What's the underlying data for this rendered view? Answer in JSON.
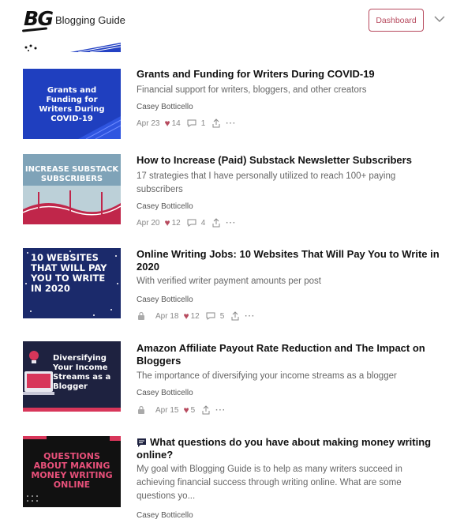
{
  "header": {
    "logo_text": "BG",
    "site_name": "Blogging Guide",
    "dashboard_label": "Dashboard"
  },
  "posts": [
    {
      "thumb_text": "Grants and Funding for Writers During COVID-19",
      "title": "Grants and Funding for Writers During COVID-19",
      "subtitle": "Financial support for writers, bloggers, and other creators",
      "author": "Casey Botticello",
      "date": "Apr 23",
      "likes": "14",
      "comments": "1",
      "locked": false
    },
    {
      "thumb_text": "INCREASE SUBSTACK SUBSCRIBERS",
      "title": "How to Increase (Paid) Substack Newsletter Subscribers",
      "subtitle": "17 strategies that I have personally utilized to reach 100+ paying subscribers",
      "author": "Casey Botticello",
      "date": "Apr 20",
      "likes": "12",
      "comments": "4",
      "locked": false
    },
    {
      "thumb_text": "10 WEBSITES THAT WILL PAY YOU TO WRITE IN 2020",
      "title": "Online Writing Jobs: 10 Websites That Will Pay You to Write in 2020",
      "subtitle": "With verified writer payment amounts per post",
      "author": "Casey Botticello",
      "date": "Apr 18",
      "likes": "12",
      "comments": "5",
      "locked": true
    },
    {
      "thumb_text": "Diversifying Your Income Streams as a Blogger",
      "title": "Amazon Affiliate Payout Rate Reduction and The Impact on Bloggers",
      "subtitle": "The importance of diversifying your income streams as a blogger",
      "author": "Casey Botticello",
      "date": "Apr 15",
      "likes": "5",
      "comments": "",
      "locked": true
    },
    {
      "thumb_text": "QUESTIONS ABOUT MAKING MONEY WRITING ONLINE",
      "title": "What questions do you have about making money writing online?",
      "subtitle": "My goal with Blogging Guide is to help as many writers succeed in achieving financial success through writing online. What are some questions yo...",
      "author": "Casey Botticello"
    }
  ],
  "colors": {
    "accent": "#b74a5e",
    "thumb1_bg": "#1f3fbf",
    "thumb2_bg": "#2b5d8c",
    "thumb3_bg": "#1b2a6b",
    "thumb4_bg": "#1e2240",
    "thumb5_bg": "#111111"
  }
}
